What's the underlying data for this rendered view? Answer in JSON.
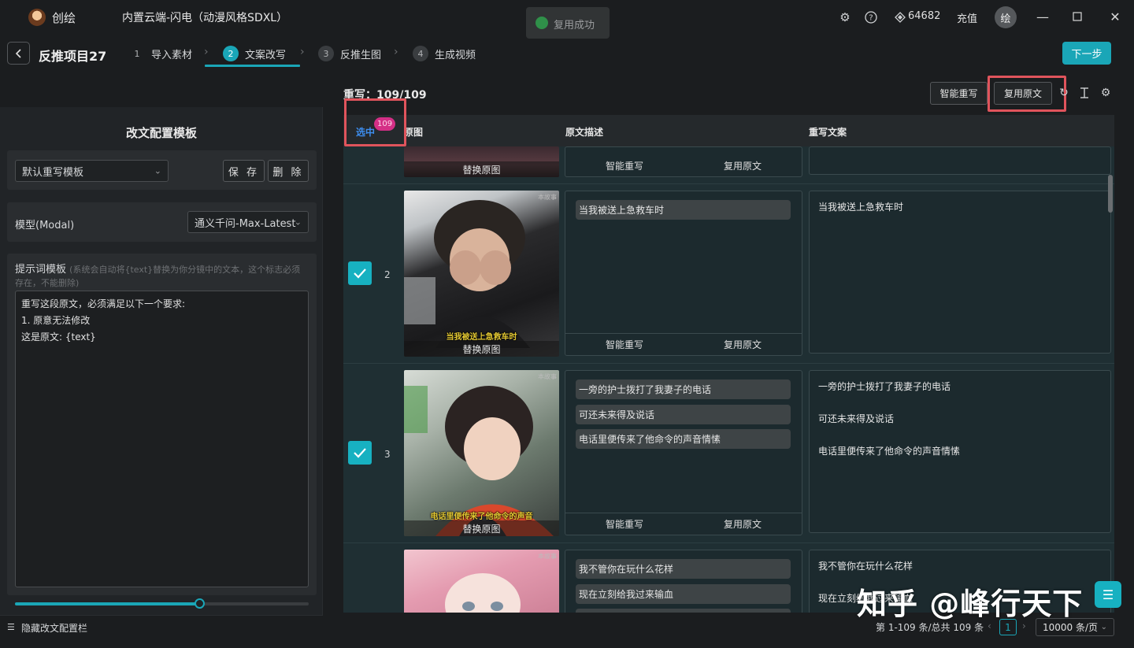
{
  "app": {
    "name": "创绘",
    "window_title": "内置云端-闪电（动漫风格SDXL）",
    "credits": "64682",
    "recharge": "充值",
    "avatar": "绘"
  },
  "toast": {
    "text": "复用成功"
  },
  "header": {
    "project_title": "反推项目27",
    "steps": [
      {
        "num": "1",
        "label": "导入素材"
      },
      {
        "num": "2",
        "label": "文案改写"
      },
      {
        "num": "3",
        "label": "反推生图"
      },
      {
        "num": "4",
        "label": "生成视频"
      }
    ],
    "next_label": "下一步"
  },
  "left": {
    "title": "改文配置模板",
    "template_select": "默认重写模板",
    "save_label": "保 存",
    "delete_label": "删 除",
    "model_label": "模型(Modal)",
    "model_value": "通义千问-Max-Latest",
    "prompt_label": "提示词模板",
    "prompt_hint": "(系统会自动将{text}替换为你分镜中的文本，这个标志必须存在，不能删除)",
    "prompt_lines": [
      "重写这段原文，必须满足以下一个要求:",
      "1. 原意无法修改",
      "这是原文: {text}"
    ],
    "slider_value": 0.63,
    "hide_label": "隐藏改文配置栏"
  },
  "main": {
    "rewrite_count": "重写：109/109",
    "smart_rewrite": "智能重写",
    "reuse_original": "复用原文",
    "columns": {
      "select": "选中",
      "original_image": "原图",
      "original_desc": "原文描述",
      "rewrite": "重写文案"
    },
    "selected_badge": "109",
    "row_actions": {
      "replace_image": "替换原图",
      "smart_rewrite": "智能重写",
      "reuse_original": "复用原文"
    },
    "rows": [
      {
        "num": "2",
        "caption": "当我被送上急救车时",
        "segments": [
          "当我被送上急救车时"
        ],
        "rewrites": [
          "当我被送上急救车时"
        ]
      },
      {
        "num": "3",
        "caption": "电话里便传来了他命令的声音",
        "segments": [
          "一旁的护士拨打了我妻子的电话",
          "可还未来得及说话",
          "电话里便传来了他命令的声音情愫"
        ],
        "rewrites": [
          "一旁的护士拨打了我妻子的电话",
          "可还未来得及说话",
          "电话里便传来了他命令的声音情愫"
        ]
      },
      {
        "segments": [
          "我不管你在玩什么花样",
          "现在立刻给我过来输血"
        ],
        "rewrites": [
          "我不管你在玩什么花样",
          "现在立刻给我过来输血"
        ]
      }
    ],
    "thumb_watermark": "本故事"
  },
  "footer": {
    "summary": "第 1-109 条/总共 109 条",
    "current_page": "1",
    "page_size": "10000 条/页"
  },
  "watermark": "知乎 @峰行天下",
  "colors": {
    "accent": "#1aa6b7",
    "highlight": "#e0545c",
    "badge": "#d42f86"
  }
}
